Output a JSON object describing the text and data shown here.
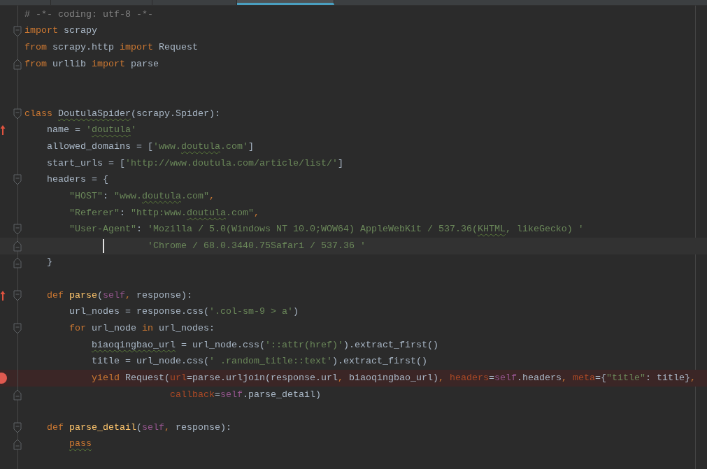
{
  "tabs": [
    {
      "selected": false
    },
    {
      "selected": false
    },
    {
      "selected": false
    },
    {
      "selected": true
    }
  ],
  "lines": [
    {
      "tokens": [
        {
          "text": "# -*- coding: utf-8 -*-",
          "kind": "comment"
        }
      ]
    },
    {
      "fold_start": true,
      "tokens": [
        {
          "text": "import",
          "kind": "keyword"
        },
        {
          "text": " scrapy",
          "kind": "plain"
        }
      ]
    },
    {
      "tokens": [
        {
          "text": "from",
          "kind": "keyword"
        },
        {
          "text": " scrapy.http ",
          "kind": "plain"
        },
        {
          "text": "import",
          "kind": "keyword"
        },
        {
          "text": " Request",
          "kind": "plain"
        }
      ]
    },
    {
      "fold_end": true,
      "tokens": [
        {
          "text": "from",
          "kind": "keyword"
        },
        {
          "text": " urllib ",
          "kind": "plain"
        },
        {
          "text": "import",
          "kind": "keyword"
        },
        {
          "text": " parse",
          "kind": "plain"
        }
      ]
    },
    {
      "blank": true
    },
    {
      "blank": true
    },
    {
      "fold_start": true,
      "tokens": [
        {
          "text": "class",
          "kind": "keyword"
        },
        {
          "text": " DoutulaSpider",
          "kind": "plain",
          "warn": true
        },
        {
          "text": "(scrapy.Spider):",
          "kind": "plain"
        }
      ]
    },
    {
      "override": true,
      "tokens": [
        {
          "text": "    name = ",
          "kind": "plain"
        },
        {
          "text": "'",
          "kind": "string"
        },
        {
          "text": "doutula",
          "kind": "string",
          "warn": true
        },
        {
          "text": "'",
          "kind": "string"
        }
      ]
    },
    {
      "tokens": [
        {
          "text": "    allowed_domains = [",
          "kind": "plain"
        },
        {
          "text": "'www.",
          "kind": "string"
        },
        {
          "text": "doutula",
          "kind": "string",
          "warn": true
        },
        {
          "text": ".com'",
          "kind": "string"
        },
        {
          "text": "]",
          "kind": "plain"
        }
      ]
    },
    {
      "tokens": [
        {
          "text": "    start_urls = [",
          "kind": "plain"
        },
        {
          "text": "'http://www.doutula.com/article/list/'",
          "kind": "string"
        },
        {
          "text": "]",
          "kind": "plain"
        }
      ]
    },
    {
      "fold_start": true,
      "tokens": [
        {
          "text": "    headers = {",
          "kind": "plain"
        }
      ]
    },
    {
      "tokens": [
        {
          "text": "        \"HOST\"",
          "kind": "string"
        },
        {
          "text": ": ",
          "kind": "plain"
        },
        {
          "text": "\"www.",
          "kind": "string"
        },
        {
          "text": "doutula",
          "kind": "string",
          "warn": true
        },
        {
          "text": ".com\"",
          "kind": "string"
        },
        {
          "text": ",",
          "kind": "keyword"
        }
      ]
    },
    {
      "tokens": [
        {
          "text": "        \"Referer\"",
          "kind": "string"
        },
        {
          "text": ": ",
          "kind": "plain"
        },
        {
          "text": "\"http:www.",
          "kind": "string"
        },
        {
          "text": "doutula",
          "kind": "string",
          "warn": true
        },
        {
          "text": ".com\"",
          "kind": "string"
        },
        {
          "text": ",",
          "kind": "keyword"
        }
      ]
    },
    {
      "fold_start": true,
      "tokens": [
        {
          "text": "        \"User-Agent\"",
          "kind": "string"
        },
        {
          "text": ": ",
          "kind": "plain"
        },
        {
          "text": "'Mozilla / 5.0(Windows NT 10.0;WOW64) AppleWebKit / 537.36(",
          "kind": "string"
        },
        {
          "text": "KHTML",
          "kind": "string",
          "warn": true
        },
        {
          "text": ", likeGecko) '",
          "kind": "string"
        }
      ]
    },
    {
      "fold_end": true,
      "current": true,
      "caret": true,
      "tokens": [
        {
          "text": "                      'Chrome / 68.0.3440.75Safari / 537.36 '",
          "kind": "string"
        }
      ]
    },
    {
      "fold_end": true,
      "tokens": [
        {
          "text": "    }",
          "kind": "plain"
        }
      ]
    },
    {
      "blank": true
    },
    {
      "override": true,
      "fold_start": true,
      "tokens": [
        {
          "text": "    def",
          "kind": "keyword"
        },
        {
          "text": " parse",
          "kind": "defname"
        },
        {
          "text": "(",
          "kind": "plain"
        },
        {
          "text": "self",
          "kind": "self"
        },
        {
          "text": ",",
          "kind": "keyword"
        },
        {
          "text": " response):",
          "kind": "plain"
        }
      ]
    },
    {
      "tokens": [
        {
          "text": "        url_nodes = response.css(",
          "kind": "plain"
        },
        {
          "text": "'.col-sm-9 > a'",
          "kind": "string"
        },
        {
          "text": ")",
          "kind": "plain"
        }
      ]
    },
    {
      "fold_start": true,
      "tokens": [
        {
          "text": "        for",
          "kind": "keyword"
        },
        {
          "text": " url_node ",
          "kind": "plain"
        },
        {
          "text": "in",
          "kind": "keyword"
        },
        {
          "text": " url_nodes:",
          "kind": "plain"
        }
      ]
    },
    {
      "tokens": [
        {
          "text": "            biaoqingbao_url",
          "kind": "plain",
          "warn": true
        },
        {
          "text": " = url_node.css(",
          "kind": "plain"
        },
        {
          "text": "'::attr(href)'",
          "kind": "string"
        },
        {
          "text": ").extract_first()",
          "kind": "plain"
        }
      ]
    },
    {
      "tokens": [
        {
          "text": "            title = url_node.css(",
          "kind": "plain"
        },
        {
          "text": "' .random_title::text'",
          "kind": "string"
        },
        {
          "text": ").extract_first()",
          "kind": "plain"
        }
      ]
    },
    {
      "breakpoint": true,
      "tokens": [
        {
          "text": "            yield",
          "kind": "keyword"
        },
        {
          "text": " Request(",
          "kind": "plain"
        },
        {
          "text": "url",
          "kind": "param"
        },
        {
          "text": "=parse.urljoin(response.url",
          "kind": "plain"
        },
        {
          "text": ",",
          "kind": "keyword"
        },
        {
          "text": " biaoqingbao_url)",
          "kind": "plain"
        },
        {
          "text": ", ",
          "kind": "keyword"
        },
        {
          "text": "headers",
          "kind": "param"
        },
        {
          "text": "=",
          "kind": "plain"
        },
        {
          "text": "self",
          "kind": "self"
        },
        {
          "text": ".headers",
          "kind": "plain"
        },
        {
          "text": ", ",
          "kind": "keyword"
        },
        {
          "text": "meta",
          "kind": "param"
        },
        {
          "text": "={",
          "kind": "plain"
        },
        {
          "text": "\"title\"",
          "kind": "string"
        },
        {
          "text": ": title}",
          "kind": "plain"
        },
        {
          "text": ",",
          "kind": "keyword"
        }
      ]
    },
    {
      "fold_end": true,
      "tokens": [
        {
          "text": "                          callback",
          "kind": "param"
        },
        {
          "text": "=",
          "kind": "plain"
        },
        {
          "text": "self",
          "kind": "self"
        },
        {
          "text": ".parse_detail)",
          "kind": "plain"
        }
      ]
    },
    {
      "blank": true
    },
    {
      "fold_start": true,
      "tokens": [
        {
          "text": "    def",
          "kind": "keyword"
        },
        {
          "text": " parse_detail",
          "kind": "defname"
        },
        {
          "text": "(",
          "kind": "plain"
        },
        {
          "text": "self",
          "kind": "self"
        },
        {
          "text": ",",
          "kind": "keyword"
        },
        {
          "text": " response):",
          "kind": "plain"
        }
      ]
    },
    {
      "fold_end": true,
      "tokens": [
        {
          "text": "        pass",
          "kind": "keyword",
          "warn": true
        }
      ]
    },
    {
      "blank": true
    }
  ]
}
